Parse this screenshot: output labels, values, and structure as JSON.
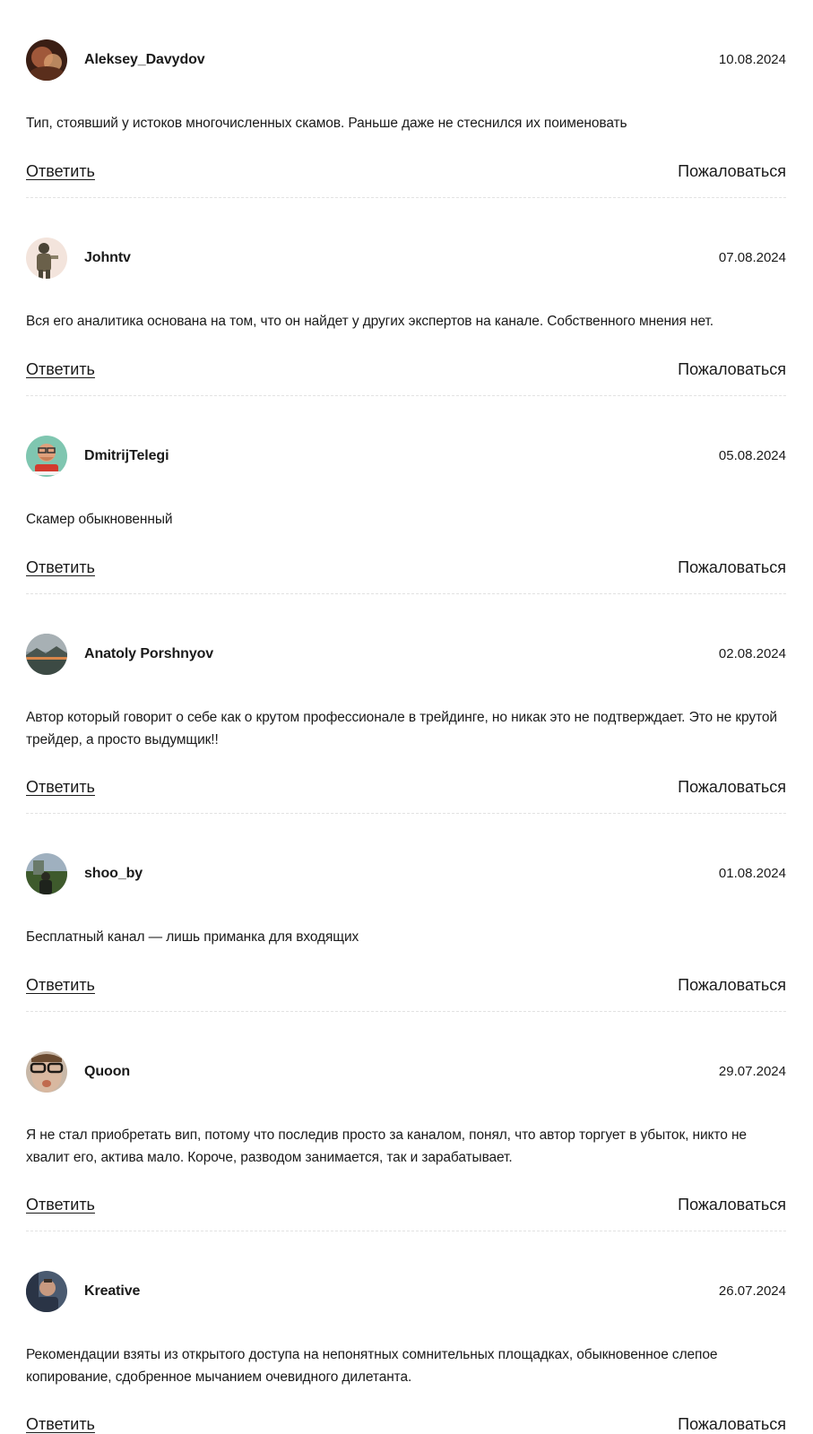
{
  "comments": [
    {
      "username": "Aleksey_Davydov",
      "date": "10.08.2024",
      "text": "Тип, стоявший у истоков многочисленных скамов. Раньше даже не стеснился их поименовать",
      "reply_label": "Ответить",
      "report_label": "Пожаловаться",
      "avatar": {
        "description_icon": "person-photo-icon",
        "colors": [
          "#5a2e1c",
          "#a0583a",
          "#d8a070"
        ]
      }
    },
    {
      "username": "Johntv",
      "date": "07.08.2024",
      "text": "Вся его аналитика основана на том, что он найдет у других экспертов на канале. Собственного мнения нет.",
      "reply_label": "Ответить",
      "report_label": "Пожаловаться",
      "avatar": {
        "description_icon": "person-photo-icon",
        "colors": [
          "#f3e4dc",
          "#4a4436",
          "#8a8068"
        ]
      }
    },
    {
      "username": "DmitrijTelegi",
      "date": "05.08.2024",
      "text": "Скамер обыкновенный",
      "reply_label": "Ответить",
      "report_label": "Пожаловаться",
      "avatar": {
        "description_icon": "cartoon-avatar-icon",
        "colors": [
          "#7fc6b0",
          "#c98058",
          "#d33b2e"
        ]
      }
    },
    {
      "username": "Anatoly Porshnyov",
      "date": "02.08.2024",
      "text": "Автор который говорит о себе как о крутом профессионале в трейдинге, но никак это не подтверждает. Это не крутой трейдер, а просто выдумщик!!",
      "reply_label": "Ответить",
      "report_label": "Пожаловаться",
      "avatar": {
        "description_icon": "landscape-photo-icon",
        "colors": [
          "#7d8a90",
          "#3c4a44",
          "#d8864a"
        ]
      }
    },
    {
      "username": "shoo_by",
      "date": "01.08.2024",
      "text": "Бесплатный канал — лишь приманка для входящих",
      "reply_label": "Ответить",
      "report_label": "Пожаловаться",
      "avatar": {
        "description_icon": "person-photo-icon",
        "colors": [
          "#9fb0bf",
          "#3e5a2c",
          "#1e231c"
        ]
      }
    },
    {
      "username": "Quoon",
      "date": "29.07.2024",
      "text": "Я не стал приобретать вип, потому что последив просто за каналом, понял, что автор торгует в убыток, никто не хвалит его, актива мало. Короче, разводом занимается, так и зарабатывает.",
      "reply_label": "Ответить",
      "report_label": "Пожаловаться",
      "avatar": {
        "description_icon": "person-photo-icon",
        "colors": [
          "#d8b8a0",
          "#c06a4e",
          "#1e1a16"
        ]
      }
    },
    {
      "username": "Kreative",
      "date": "26.07.2024",
      "text": "Рекомендации взяты из открытого доступа на непонятных сомнительных площадках, обыкновенное слепое копирование, сдобренное мычанием очевидного дилетанта.",
      "reply_label": "Ответить",
      "report_label": "Пожаловаться",
      "avatar": {
        "description_icon": "person-photo-icon",
        "colors": [
          "#2a3446",
          "#c89a80",
          "#4a5a70"
        ]
      }
    }
  ]
}
